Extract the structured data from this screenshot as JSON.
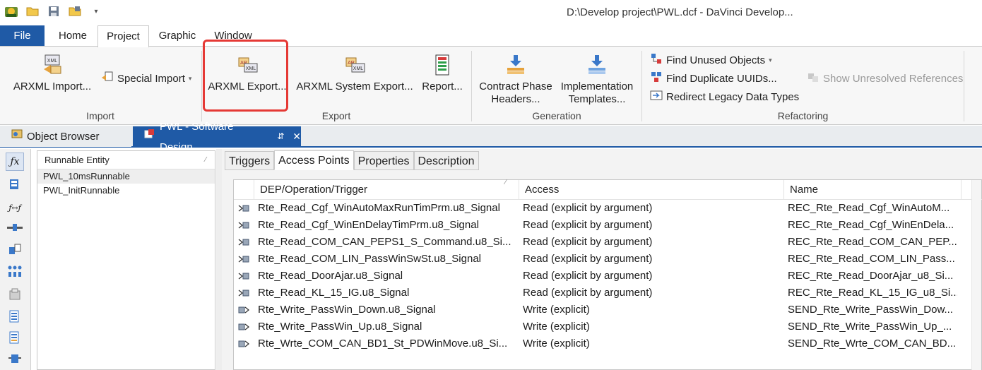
{
  "title_bar": {
    "title": "D:\\Develop project\\PWL.dcf - DaVinci Develop...",
    "quick_access": [
      "app-icon",
      "open-folder-icon",
      "save-icon",
      "save-as-icon",
      "customize-arrow-icon"
    ],
    "customize_glyph": "▾"
  },
  "ribbon_tabs": {
    "file": "File",
    "home": "Home",
    "project": "Project",
    "graphic": "Graphic",
    "window": "Window"
  },
  "ribbon": {
    "import_group": {
      "label": "Import",
      "arxml_import": "ARXML Import...",
      "special_import": "Special Import",
      "special_import_arrow": "▾"
    },
    "export_group": {
      "label": "Export",
      "arxml_export": "ARXML Export...",
      "arxml_system_export": "ARXML System Export...",
      "report": "Report..."
    },
    "generation_group": {
      "label": "Generation",
      "contract_phase_line1": "Contract Phase",
      "contract_phase_line2": "Headers...",
      "implementation_line1": "Implementation",
      "implementation_line2": "Templates..."
    },
    "refactoring_group": {
      "label": "Refactoring",
      "find_unused": "Find Unused Objects",
      "find_unused_arrow": "▾",
      "find_duplicate": "Find Duplicate UUIDs...",
      "redirect_legacy": "Redirect Legacy Data Types",
      "show_unresolved": "Show Unresolved References"
    },
    "icon_text": {
      "arxml": "XML",
      "ar": "AR"
    }
  },
  "doc_tabs": {
    "object_browser": "Object Browser",
    "pwl": "PWL - Software Design",
    "pin_glyph": "⇵",
    "close_glyph": "✕"
  },
  "left_toolbar": {
    "icons": [
      "function-icon",
      "component-icon",
      "function-mapping-icon",
      "port-icon",
      "data-type-icon",
      "dots-icon",
      "package-icon",
      "list-icon",
      "list2-icon",
      "bus-icon"
    ],
    "function_glyph": "ƒx",
    "mapping_glyph": "ƒ↔ƒ"
  },
  "runnables": {
    "header": "Runnable Entity",
    "sort_glyph": "⁄",
    "items": [
      "PWL_10msRunnable",
      "PWL_InitRunnable"
    ]
  },
  "sub_tabs": [
    "Triggers",
    "Access Points",
    "Properties",
    "Description"
  ],
  "access_grid": {
    "columns": [
      "DEP/Operation/Trigger",
      "Access",
      "Name"
    ],
    "sort_glyph": "⁄",
    "rows": [
      {
        "icon": "read-port-icon",
        "dep": "Rte_Read_Cgf_WinAutoMaxRunTimPrm.u8_Signal",
        "access": "Read (explicit by argument)",
        "name": "REC_Rte_Read_Cgf_WinAutoM..."
      },
      {
        "icon": "read-port-icon",
        "dep": "Rte_Read_Cgf_WinEnDelayTimPrm.u8_Signal",
        "access": "Read (explicit by argument)",
        "name": "REC_Rte_Read_Cgf_WinEnDela..."
      },
      {
        "icon": "read-port-icon",
        "dep": "Rte_Read_COM_CAN_PEPS1_S_Command.u8_Si...",
        "access": "Read (explicit by argument)",
        "name": "REC_Rte_Read_COM_CAN_PEP..."
      },
      {
        "icon": "read-port-icon",
        "dep": "Rte_Read_COM_LIN_PassWinSwSt.u8_Signal",
        "access": "Read (explicit by argument)",
        "name": "REC_Rte_Read_COM_LIN_Pass..."
      },
      {
        "icon": "read-port-icon",
        "dep": "Rte_Read_DoorAjar.u8_Signal",
        "access": "Read (explicit by argument)",
        "name": "REC_Rte_Read_DoorAjar_u8_Si..."
      },
      {
        "icon": "read-port-icon",
        "dep": "Rte_Read_KL_15_IG.u8_Signal",
        "access": "Read (explicit by argument)",
        "name": "REC_Rte_Read_KL_15_IG_u8_Si..."
      },
      {
        "icon": "write-port-icon",
        "dep": "Rte_Write_PassWin_Down.u8_Signal",
        "access": "Write (explicit)",
        "name": "SEND_Rte_Write_PassWin_Dow..."
      },
      {
        "icon": "write-port-icon",
        "dep": "Rte_Write_PassWin_Up.u8_Signal",
        "access": "Write (explicit)",
        "name": "SEND_Rte_Write_PassWin_Up_..."
      },
      {
        "icon": "write-port-icon",
        "dep": "Rte_Wrte_COM_CAN_BD1_St_PDWinMove.u8_Si...",
        "access": "Write (explicit)",
        "name": "SEND_Rte_Wrte_COM_CAN_BD..."
      }
    ]
  },
  "colors": {
    "accent": "#1f5aa6",
    "highlight": "#e53935"
  }
}
